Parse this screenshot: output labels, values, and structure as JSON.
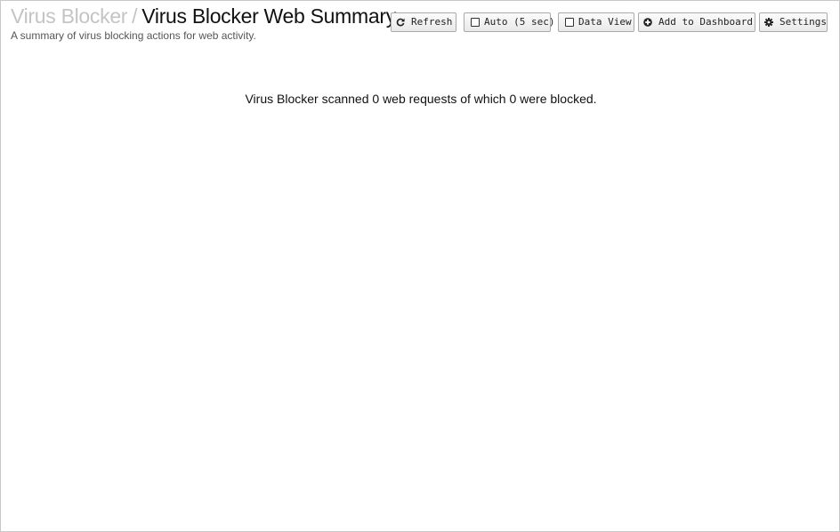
{
  "header": {
    "breadcrumb_parent": "Virus Blocker",
    "separator": "/",
    "title": "Virus Blocker Web Summary",
    "subtitle": "A summary of virus blocking actions for web activity."
  },
  "toolbar": {
    "refresh_label": "Refresh",
    "auto_label": "Auto (5 sec)",
    "auto_checked": false,
    "data_view_label": "Data View",
    "data_view_checked": false,
    "add_dashboard_label": "Add to Dashboard",
    "settings_label": "Settings"
  },
  "main": {
    "summary_text": "Virus Blocker scanned 0 web requests of which 0 were blocked."
  },
  "icons": {
    "refresh": "refresh-icon",
    "auto": "checkbox-icon",
    "data_view": "checkbox-icon",
    "add_dashboard": "plus-circle-icon",
    "settings": "gear-icon"
  }
}
